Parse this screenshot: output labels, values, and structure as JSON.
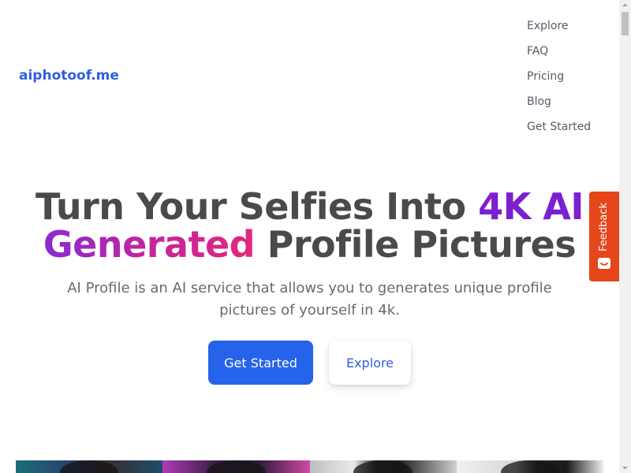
{
  "header": {
    "logo": "aiphotoof.me",
    "nav": [
      {
        "label": "Explore"
      },
      {
        "label": "FAQ"
      },
      {
        "label": "Pricing"
      },
      {
        "label": "Blog"
      },
      {
        "label": "Get Started"
      }
    ]
  },
  "hero": {
    "title_part1": "Turn Your Selfies Into ",
    "title_highlight1": "4K AI",
    "title_highlight2": "Generated",
    "title_part2": " Profile Pictures",
    "subtitle": "AI Profile is an AI service that allows you to generates unique profile pictures of yourself in 4k.",
    "primary_button": "Get Started",
    "secondary_button": "Explore"
  },
  "feedback": {
    "label": "Feedback",
    "icon": "feedback-smile-icon"
  },
  "gallery": {
    "count": 4
  },
  "colors": {
    "brand": "#2f5fe0",
    "primary_button": "#2563eb",
    "highlight_purple": "#7b1fd1",
    "highlight_pink": "#e0297d",
    "feedback": "#e5461a",
    "heading": "#4a4a4a"
  }
}
